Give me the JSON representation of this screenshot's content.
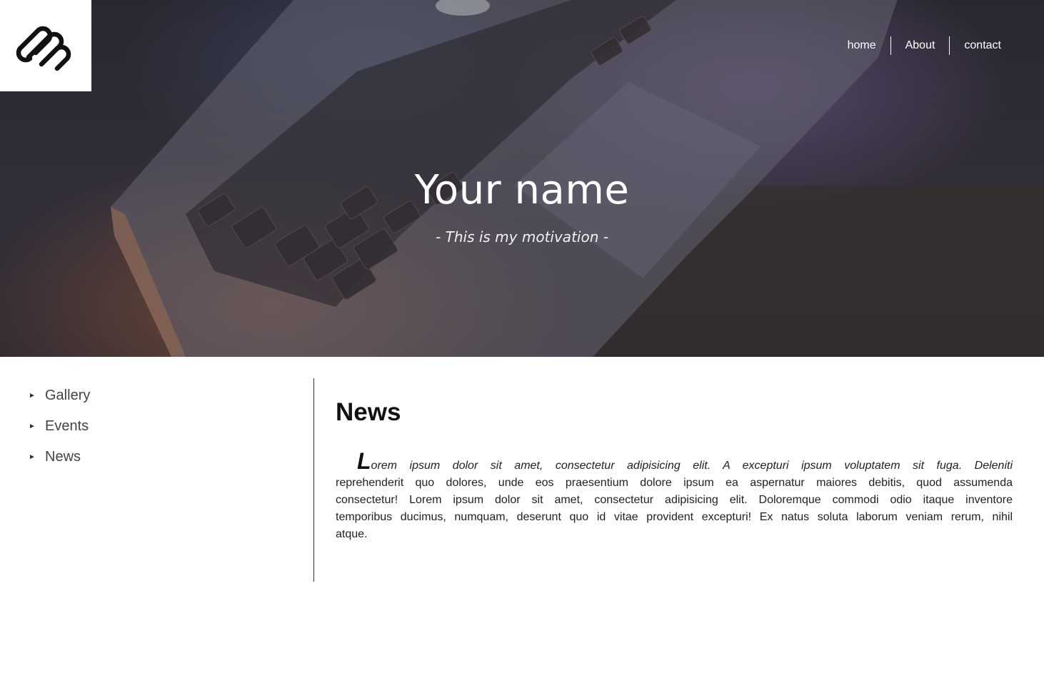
{
  "header": {
    "logo_icon": "squarespace-logo-icon",
    "nav": [
      {
        "label": "home"
      },
      {
        "label": "About"
      },
      {
        "label": "contact"
      }
    ]
  },
  "hero": {
    "title": "Your name",
    "subtitle": "- This is my motivation -",
    "background_image": "laptop-photo"
  },
  "sidebar": {
    "items": [
      {
        "label": "Gallery",
        "icon": "triangle-right-icon"
      },
      {
        "label": "Events",
        "icon": "triangle-right-icon"
      },
      {
        "label": "News",
        "icon": "triangle-right-icon"
      }
    ]
  },
  "main": {
    "heading": "News",
    "article": {
      "drop_cap": "L",
      "lead": "orem ipsum dolor sit amet, consectetur adipisicing elit. A excepturi ipsum voluptatem sit fuga. Deleniti",
      "body": "reprehenderit quo dolores, unde eos praesentium dolore ipsum ea aspernatur maiores debitis, quod assumenda consectetur! Lorem ipsum dolor sit amet, consectetur adipisicing elit. Doloremque commodi odio itaque inventore temporibus ducimus, numquam, deserunt quo id vitae provident excepturi! Ex natus soluta laborum veniam rerum, nihil atque."
    }
  }
}
